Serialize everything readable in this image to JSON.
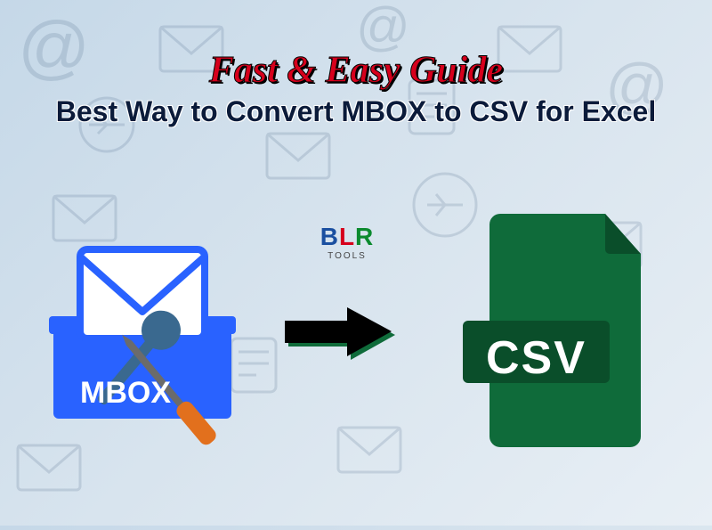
{
  "title": {
    "line1": "Fast & Easy Guide",
    "line2": "Best Way to Convert MBOX to CSV for Excel"
  },
  "source_format_label": "MBOX",
  "target_format_label": "CSV",
  "logo": {
    "letters": "BLR",
    "sub": "TOOLS"
  },
  "colors": {
    "mbox_blue": "#2962ff",
    "csv_green": "#0f6b3a",
    "csv_dark": "#0a4e2a",
    "arrow": "#000000",
    "arrow_shadow": "#0f6b3a",
    "accent_red": "#d6001c"
  }
}
